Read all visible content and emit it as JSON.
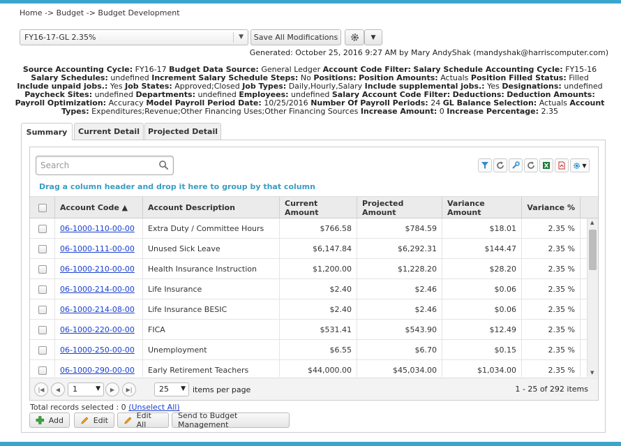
{
  "breadcrumb": "Home -> Budget -> Budget Development",
  "budget_select": {
    "value": "FY16-17-GL 2.35%"
  },
  "toolbar": {
    "save_all_label": "Save All Modifications"
  },
  "generated": "Generated: October 25, 2016 9:27 AM by Mary AndyShak (mandyshak@harriscomputer.com)",
  "params": [
    {
      "k": "Source Accounting Cycle:",
      "v": "FY16-17"
    },
    {
      "k": "Budget Data Source:",
      "v": "General Ledger"
    },
    {
      "k": "Account Code Filter:",
      "v": ""
    },
    {
      "k": "Salary Schedule Accounting Cycle:",
      "v": "FY15-16"
    },
    {
      "k": "Salary Schedules:",
      "v": "undefined"
    },
    {
      "k": "Increment Salary Schedule Steps:",
      "v": "No"
    },
    {
      "k": "Positions:",
      "v": ""
    },
    {
      "k": "Position Amounts:",
      "v": "Actuals"
    },
    {
      "k": "Position Filled Status:",
      "v": "Filled"
    },
    {
      "k": "Include unpaid jobs.:",
      "v": "Yes"
    },
    {
      "k": "Job States:",
      "v": "Approved;Closed"
    },
    {
      "k": "Job Types:",
      "v": "Daily,Hourly,Salary"
    },
    {
      "k": "Include supplemental jobs.:",
      "v": "Yes"
    },
    {
      "k": "Designations:",
      "v": "undefined"
    },
    {
      "k": "Paycheck Sites:",
      "v": "undefined"
    },
    {
      "k": "Departments:",
      "v": "undefined"
    },
    {
      "k": "Employees:",
      "v": "undefined"
    },
    {
      "k": "Salary Account Code Filter:",
      "v": ""
    },
    {
      "k": "Deductions:",
      "v": ""
    },
    {
      "k": "Deduction Amounts:",
      "v": ""
    },
    {
      "k": "Payroll Optimization:",
      "v": "Accuracy"
    },
    {
      "k": "Model Payroll Period Date:",
      "v": "10/25/2016"
    },
    {
      "k": "Number Of Payroll Periods:",
      "v": "24"
    },
    {
      "k": "GL Balance Selection:",
      "v": "Actuals"
    },
    {
      "k": "Account Types:",
      "v": "Expenditures;Revenue;Other Financing Uses;Other Financing Sources"
    },
    {
      "k": "Increase Amount:",
      "v": "0"
    },
    {
      "k": "Increase Percentage:",
      "v": "2.35"
    }
  ],
  "tabs": [
    {
      "label": "Summary"
    },
    {
      "label": "Current Detail"
    },
    {
      "label": "Projected Detail"
    }
  ],
  "search": {
    "placeholder": "Search"
  },
  "group_hint": "Drag a column header and drop it here to group by that column",
  "columns": [
    {
      "label": "Account Code ▲"
    },
    {
      "label": "Account Description"
    },
    {
      "label": "Current Amount"
    },
    {
      "label": "Projected Amount"
    },
    {
      "label": "Variance Amount"
    },
    {
      "label": "Variance %"
    }
  ],
  "rows": [
    {
      "code": "06-1000-110-00-00",
      "desc": "Extra Duty / Committee Hours",
      "current": "$766.58",
      "projected": "$784.59",
      "variance": "$18.01",
      "pct": "2.35 %"
    },
    {
      "code": "06-1000-111-00-00",
      "desc": "Unused Sick Leave",
      "current": "$6,147.84",
      "projected": "$6,292.31",
      "variance": "$144.47",
      "pct": "2.35 %"
    },
    {
      "code": "06-1000-210-00-00",
      "desc": "Health Insurance Instruction",
      "current": "$1,200.00",
      "projected": "$1,228.20",
      "variance": "$28.20",
      "pct": "2.35 %"
    },
    {
      "code": "06-1000-214-00-00",
      "desc": "Life Insurance",
      "current": "$2.40",
      "projected": "$2.46",
      "variance": "$0.06",
      "pct": "2.35 %"
    },
    {
      "code": "06-1000-214-08-00",
      "desc": "Life Insurance BESIC",
      "current": "$2.40",
      "projected": "$2.46",
      "variance": "$0.06",
      "pct": "2.35 %"
    },
    {
      "code": "06-1000-220-00-00",
      "desc": "FICA",
      "current": "$531.41",
      "projected": "$543.90",
      "variance": "$12.49",
      "pct": "2.35 %"
    },
    {
      "code": "06-1000-250-00-00",
      "desc": "Unemployment",
      "current": "$6.55",
      "projected": "$6.70",
      "variance": "$0.15",
      "pct": "2.35 %"
    },
    {
      "code": "06-1000-290-00-00",
      "desc": "Early Retirement Teachers",
      "current": "$44,000.00",
      "projected": "$45,034.00",
      "variance": "$1,034.00",
      "pct": "2.35 %"
    }
  ],
  "pager": {
    "page": "1",
    "page_size": "25",
    "items_per_page_label": "items per page",
    "range": "1 - 25 of 292 items"
  },
  "footer": {
    "total_label": "Total records selected : 0",
    "unselect_all": "(Unselect All)"
  },
  "actions": {
    "add": "Add",
    "edit": "Edit",
    "edit_all": "Edit All",
    "send": "Send to Budget Management"
  }
}
